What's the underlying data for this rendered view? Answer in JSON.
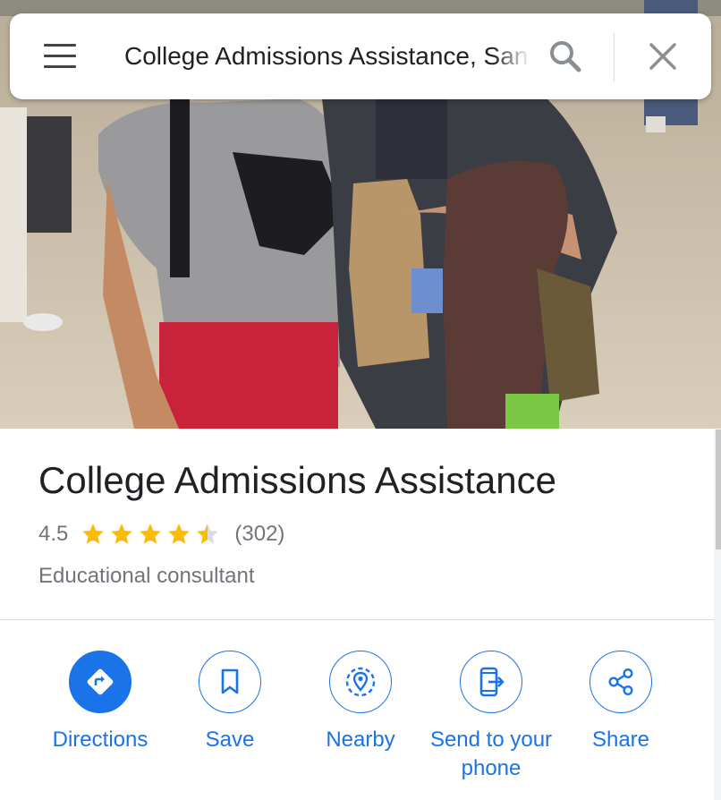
{
  "search": {
    "value": "College Admissions Assistance, San Diego"
  },
  "place": {
    "title": "College Admissions Assistance",
    "rating": "4.5",
    "rating_value": 4.5,
    "stars_max": 5,
    "review_count": "(302)",
    "category": "Educational consultant"
  },
  "actions": [
    {
      "label": "Directions",
      "icon": "directions-icon"
    },
    {
      "label": "Save",
      "icon": "bookmark-icon"
    },
    {
      "label": "Nearby",
      "icon": "nearby-icon"
    },
    {
      "label": "Send to your phone",
      "icon": "send-to-phone-icon"
    },
    {
      "label": "Share",
      "icon": "share-icon"
    }
  ],
  "colors": {
    "accent": "#1a73e8",
    "star": "#fbbc04",
    "star_empty": "#dadce0",
    "title": "#202124",
    "secondary": "#70757a"
  }
}
